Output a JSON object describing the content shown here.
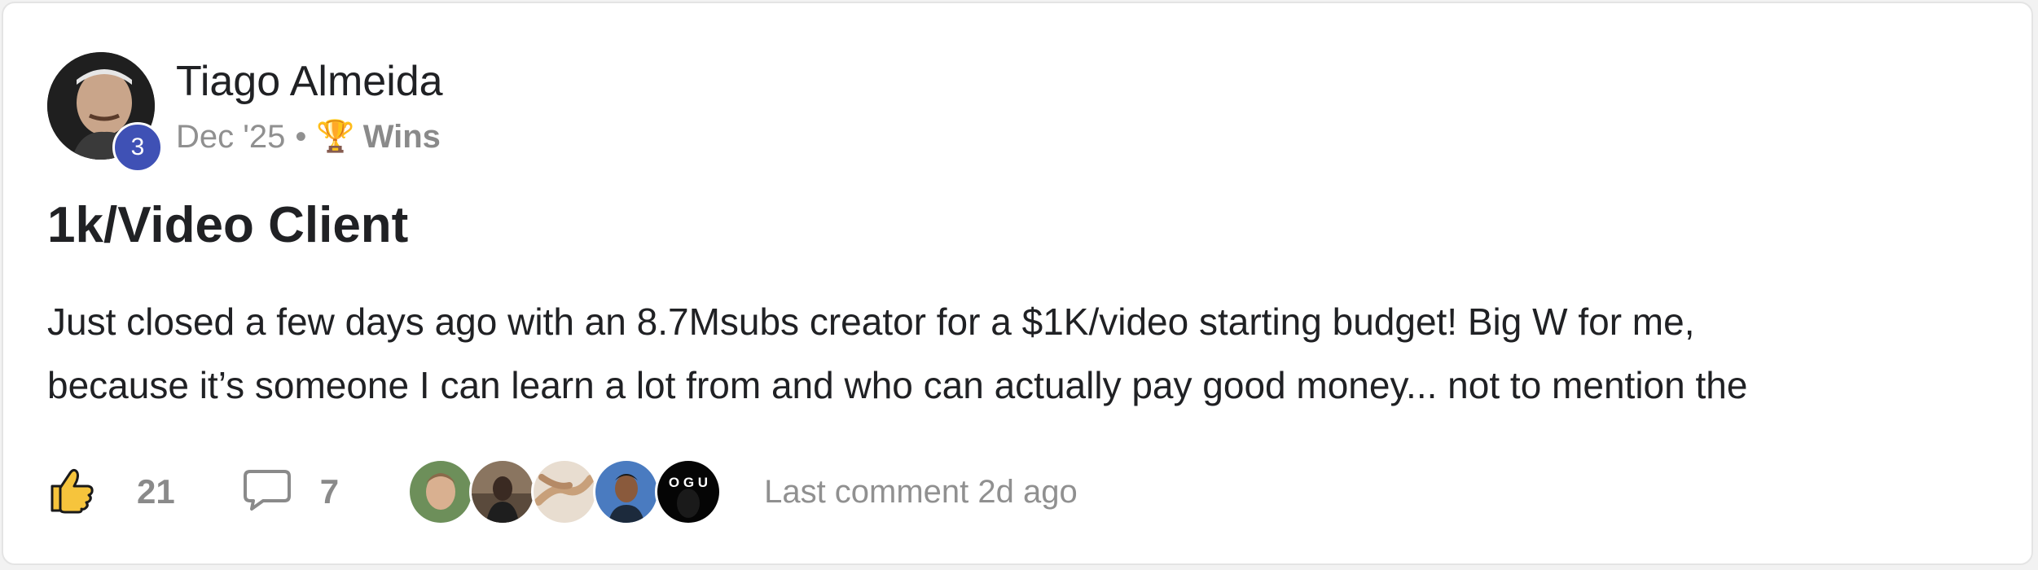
{
  "post": {
    "author": {
      "name": "Tiago Almeida",
      "level": "3"
    },
    "meta": {
      "date": "Dec '25",
      "separator": "•",
      "category_icon": "trophy-icon",
      "category": "Wins"
    },
    "title": "1k/Video Client",
    "body_lines": [
      "Just closed a few days ago with an 8.7Msubs creator for a $1K/video starting budget! Big W for me,",
      "because it’s someone I can learn a lot from and who can actually pay good money... not to mention the"
    ],
    "likes": "21",
    "comments": "7",
    "recent_commenter_count": 5,
    "recent_commenter_initials": "O G U",
    "last_comment": "Last comment 2d ago"
  },
  "colors": {
    "level_badge": "#3f51b5",
    "text_primary": "#202124",
    "text_muted": "#909090"
  }
}
